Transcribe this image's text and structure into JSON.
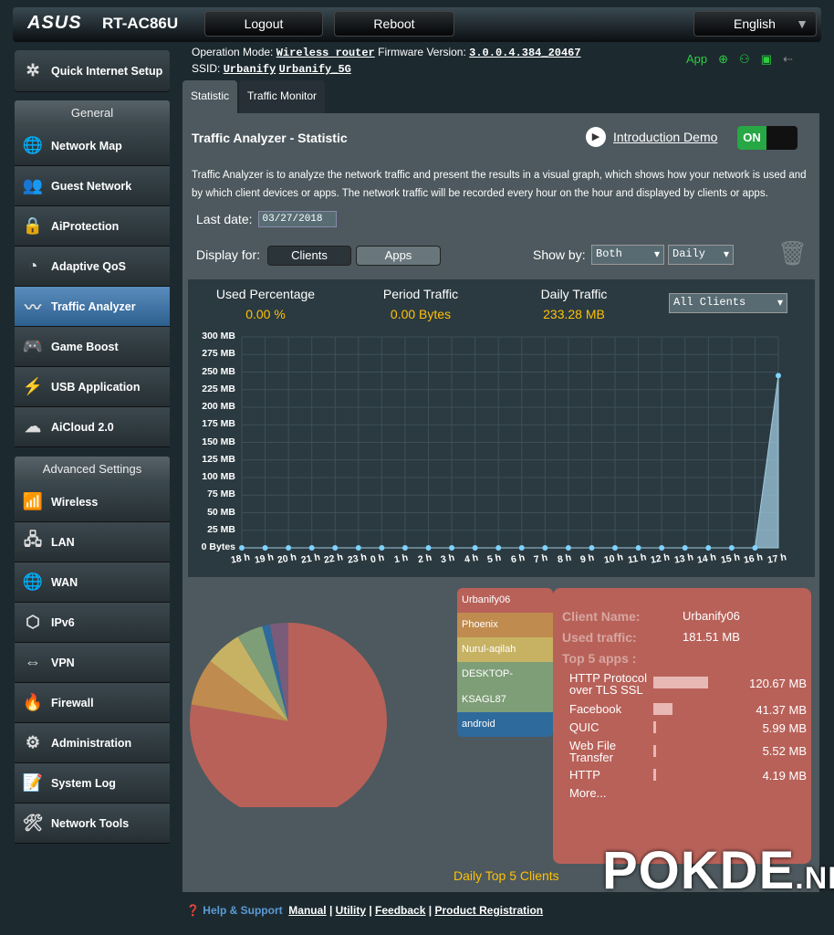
{
  "header": {
    "brand": "ASUS",
    "model": "RT-AC86U",
    "logout": "Logout",
    "reboot": "Reboot",
    "language": "English"
  },
  "info": {
    "op_mode_label": "Operation Mode:",
    "op_mode": "Wireless router",
    "fw_label": "Firmware Version:",
    "fw": "3.0.0.4.384_20467",
    "ssid_label": "SSID:",
    "ssid1": "Urbanify",
    "ssid2": "Urbanify_5G",
    "app": "App"
  },
  "sidebar": {
    "quick": "Quick Internet Setup",
    "general": "General",
    "general_items": [
      {
        "label": "Network Map",
        "icon": "globe"
      },
      {
        "label": "Guest Network",
        "icon": "guest"
      },
      {
        "label": "AiProtection",
        "icon": "lock"
      },
      {
        "label": "Adaptive QoS",
        "icon": "gauge"
      },
      {
        "label": "Traffic Analyzer",
        "icon": "pulse"
      },
      {
        "label": "Game Boost",
        "icon": "gamepad"
      },
      {
        "label": "USB Application",
        "icon": "usb"
      },
      {
        "label": "AiCloud 2.0",
        "icon": "cloud"
      }
    ],
    "advanced": "Advanced Settings",
    "advanced_items": [
      {
        "label": "Wireless",
        "icon": "wifi"
      },
      {
        "label": "LAN",
        "icon": "lan"
      },
      {
        "label": "WAN",
        "icon": "globe"
      },
      {
        "label": "IPv6",
        "icon": "ipv6"
      },
      {
        "label": "VPN",
        "icon": "vpn"
      },
      {
        "label": "Firewall",
        "icon": "fire"
      },
      {
        "label": "Administration",
        "icon": "gear"
      },
      {
        "label": "System Log",
        "icon": "log"
      },
      {
        "label": "Network Tools",
        "icon": "tools"
      }
    ]
  },
  "tabs": [
    "Statistic",
    "Traffic Monitor"
  ],
  "main": {
    "title": "Traffic Analyzer - Statistic",
    "demo": "Introduction Demo",
    "toggle": "ON",
    "description": "Traffic Analyzer is to analyze the network traffic and present the results in a visual graph, which shows how your network is used and by which client devices or apps. The network traffic will be recorded every hour on the hour and displayed by clients or apps.",
    "last_date_label": "Last date:",
    "last_date": "03/27/2018",
    "display_for": "Display for:",
    "clients": "Clients",
    "apps": "Apps",
    "show_by": "Show by:",
    "show_by_value": "Both",
    "period": "Daily",
    "used_pct_label": "Used Percentage",
    "used_pct": "0.00 %",
    "period_label": "Period Traffic",
    "period_value": "0.00 Bytes",
    "daily_label": "Daily Traffic",
    "daily_value": "233.28 MB",
    "client_filter": "All Clients"
  },
  "chart_data": [
    {
      "type": "area",
      "x": [
        "18 h",
        "19 h",
        "20 h",
        "21 h",
        "22 h",
        "23 h",
        "0 h",
        "1 h",
        "2 h",
        "3 h",
        "4 h",
        "5 h",
        "6 h",
        "7 h",
        "8 h",
        "9 h",
        "10 h",
        "11 h",
        "12 h",
        "13 h",
        "14 h",
        "15 h",
        "16 h",
        "17 h"
      ],
      "values": [
        0,
        0,
        0,
        0,
        0,
        0,
        0,
        0,
        0,
        0,
        0,
        0,
        0,
        0,
        0,
        0,
        0,
        0,
        0,
        0,
        0,
        0,
        0,
        245
      ],
      "yticks": [
        "0 Bytes",
        "25 MB",
        "50 MB",
        "75 MB",
        "100 MB",
        "125 MB",
        "150 MB",
        "175 MB",
        "200 MB",
        "225 MB",
        "250 MB",
        "275 MB",
        "300 MB"
      ],
      "ylim": [
        0,
        300
      ],
      "grid": true,
      "color": "#9fc9de"
    },
    {
      "type": "pie",
      "title": "Daily Top 5 Clients",
      "legend_placement": "right",
      "slices": [
        {
          "label": "Urbanify06",
          "value": 181.51,
          "color": "#b86159"
        },
        {
          "label": "Phoenix",
          "value": 18,
          "color": "#c08b4e"
        },
        {
          "label": "Nurul-aqilah",
          "value": 14,
          "color": "#c7b264"
        },
        {
          "label": "DESKTOP-KSAGL87",
          "value": 10,
          "color": "#7e9e77"
        },
        {
          "label": "android",
          "value": 3,
          "color": "#2f6a9c"
        },
        {
          "label": "",
          "value": 7,
          "color": "#7a5c7a"
        }
      ]
    }
  ],
  "detail": {
    "client_name_label": "Client Name:",
    "client_name": "Urbanify06",
    "used_label": "Used traffic:",
    "used": "181.51 MB",
    "top_label": "Top 5 apps :",
    "apps": [
      {
        "name": "HTTP Protocol over TLS SSL",
        "value": "120.67 MB",
        "mb": 120.67
      },
      {
        "name": "Facebook",
        "value": "41.37 MB",
        "mb": 41.37
      },
      {
        "name": "QUIC",
        "value": "5.99 MB",
        "mb": 5.99
      },
      {
        "name": "Web File Transfer",
        "value": "5.52 MB",
        "mb": 5.52
      },
      {
        "name": "HTTP",
        "value": "4.19 MB",
        "mb": 4.19
      }
    ],
    "more": "More..."
  },
  "legend": [
    "Urbanify06",
    "Phoenix",
    "Nurul-aqilah",
    "DESKTOP-",
    "KSAGL87",
    "android"
  ],
  "footer": {
    "help": "Help & Support",
    "links": [
      "Manual",
      "Utility",
      "Feedback",
      "Product Registration"
    ]
  },
  "watermark": "POKDE.NET"
}
